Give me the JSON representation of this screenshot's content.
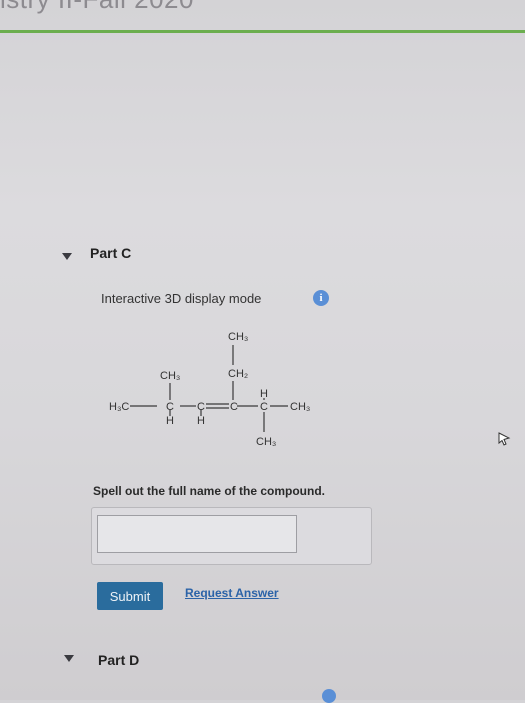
{
  "header": {
    "course_title": "istry II-Fall 2020"
  },
  "part_c": {
    "label": "Part C",
    "display_mode": "Interactive 3D display mode",
    "info_icon": "info-icon",
    "molecule": {
      "atoms": {
        "h3c_left": "H₃C",
        "ch3_top": "CH₃",
        "ch2_upper": "CH₂",
        "ch3_c2_sub": "CH₃",
        "c2": "C",
        "c3": "C",
        "c4": "C",
        "c5": "C",
        "ch3_right": "CH₃",
        "h_c2": "H",
        "h_c3": "H",
        "h_c5": "H",
        "ch3_bottom": "CH₃"
      }
    },
    "prompt": "Spell out the full name of the compound.",
    "answer": {
      "value": "",
      "placeholder": ""
    },
    "submit_label": "Submit",
    "request_answer_label": "Request Answer"
  },
  "part_d": {
    "label": "Part D"
  },
  "colors": {
    "accent_green": "#6cae4f",
    "submit_blue": "#2a6c9d",
    "link_blue": "#2b63a8",
    "info_blue": "#5a8fd6"
  }
}
